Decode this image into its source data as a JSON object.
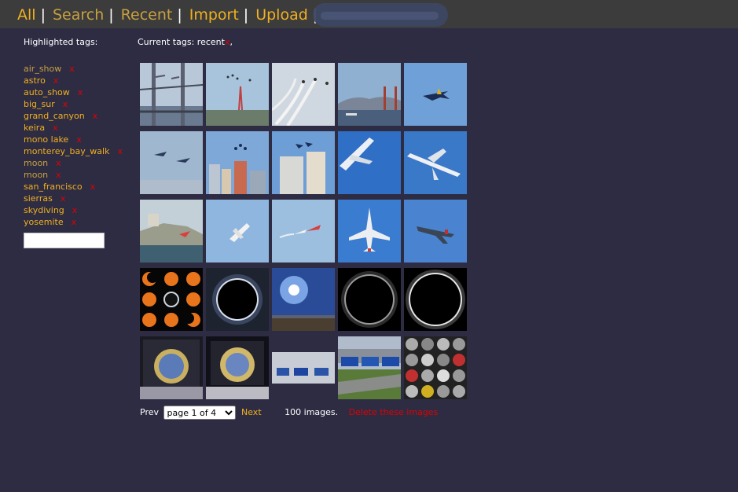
{
  "nav": {
    "items": [
      {
        "label": "All",
        "color": "#f0b020"
      },
      {
        "label": "Search",
        "color": "#c8a040"
      },
      {
        "label": "Recent",
        "color": "#c8a040"
      },
      {
        "label": "Import",
        "color": "#f0b020"
      },
      {
        "label": "Upload",
        "color": "#f0b020"
      }
    ],
    "separator": "|"
  },
  "sidebar": {
    "title": "Highlighted tags:",
    "remove_label": "x",
    "tags": [
      {
        "label": "air_show",
        "color": "#c8a040"
      },
      {
        "label": "astro",
        "color": "#f0b020"
      },
      {
        "label": "auto_show",
        "color": "#f0b020"
      },
      {
        "label": "big_sur",
        "color": "#f0b020"
      },
      {
        "label": "grand_canyon",
        "color": "#f0b020"
      },
      {
        "label": "keira",
        "color": "#f0b020"
      },
      {
        "label": "mono lake",
        "color": "#f0b020"
      },
      {
        "label": "monterey_bay_walk",
        "color": "#f0b020"
      },
      {
        "label": "moon",
        "color": "#c8a040"
      },
      {
        "label": "moon",
        "color": "#c8a040"
      },
      {
        "label": "san_francisco",
        "color": "#f0b020"
      },
      {
        "label": "sierras",
        "color": "#f0b020"
      },
      {
        "label": "skydiving",
        "color": "#f0b020"
      },
      {
        "label": "yosemite",
        "color": "#f0b020"
      }
    ],
    "input_value": ""
  },
  "current": {
    "label": "Current tags:",
    "tag": "recent",
    "remove_label": "x",
    "trailing": ","
  },
  "thumbnails": [
    [
      "bridge-airshow",
      "sutro-tower-jets",
      "smoke-trails",
      "golden-gate-bay",
      "jet-blue-sky"
    ],
    [
      "two-jets-haze",
      "blue-angels-city",
      "jets-over-building",
      "airliner-closeup",
      "airliner-blue"
    ],
    [
      "alcatraz-plane",
      "small-plane",
      "two-planes",
      "f16-front",
      "jet-side"
    ],
    [
      "eclipse-sequence",
      "eclipse-corona",
      "sun-horizon",
      "eclipse-dark",
      "eclipse-ring"
    ],
    [
      "coin-case",
      "coin-case-2",
      "blue-cars-showroom",
      "blue-cars-parking",
      "wheel-rims-wall"
    ]
  ],
  "pager": {
    "prev": "Prev",
    "select_value": "page 1 of 4",
    "next": "Next",
    "count": "100 images.",
    "delete": "Delete these images"
  }
}
